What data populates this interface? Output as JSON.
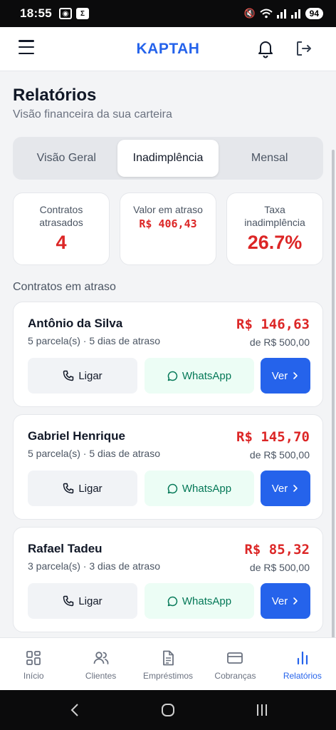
{
  "status_bar": {
    "time": "18:55",
    "battery": "94"
  },
  "header": {
    "brand": "KAPTAH"
  },
  "page": {
    "title": "Relatórios",
    "subtitle": "Visão financeira da sua carteira"
  },
  "tabs": [
    {
      "label": "Visão Geral",
      "active": false
    },
    {
      "label": "Inadimplência",
      "active": true
    },
    {
      "label": "Mensal",
      "active": false
    }
  ],
  "stats": {
    "overdue_contracts": {
      "label": "Contratos atrasados",
      "value": "4"
    },
    "overdue_value": {
      "label": "Valor em atraso",
      "value": "R$ 406,43"
    },
    "default_rate": {
      "label": "Taxa inadimplência",
      "value": "26.7%"
    }
  },
  "section_title": "Contratos em atraso",
  "contracts": [
    {
      "name": "Antônio da Silva",
      "info": "5 parcela(s) · 5 dias de atraso",
      "amount": "R$ 146,63",
      "base": "de R$ 500,00"
    },
    {
      "name": "Gabriel Henrique",
      "info": "5 parcela(s) · 5 dias de atraso",
      "amount": "R$ 145,70",
      "base": "de R$ 500,00"
    },
    {
      "name": "Rafael Tadeu",
      "info": "3 parcela(s) · 3 dias de atraso",
      "amount": "R$ 85,32",
      "base": "de R$ 500,00"
    }
  ],
  "actions": {
    "call": "Ligar",
    "whatsapp": "WhatsApp",
    "view": "Ver"
  },
  "bottom_nav": [
    {
      "label": "Início",
      "icon": "grid-icon"
    },
    {
      "label": "Clientes",
      "icon": "users-icon"
    },
    {
      "label": "Empréstimos",
      "icon": "document-icon"
    },
    {
      "label": "Cobranças",
      "icon": "card-icon"
    },
    {
      "label": "Relatórios",
      "icon": "bar-chart-icon",
      "active": true
    }
  ],
  "colors": {
    "brand": "#2563eb",
    "danger": "#dc2626",
    "whatsapp": "#047857"
  }
}
